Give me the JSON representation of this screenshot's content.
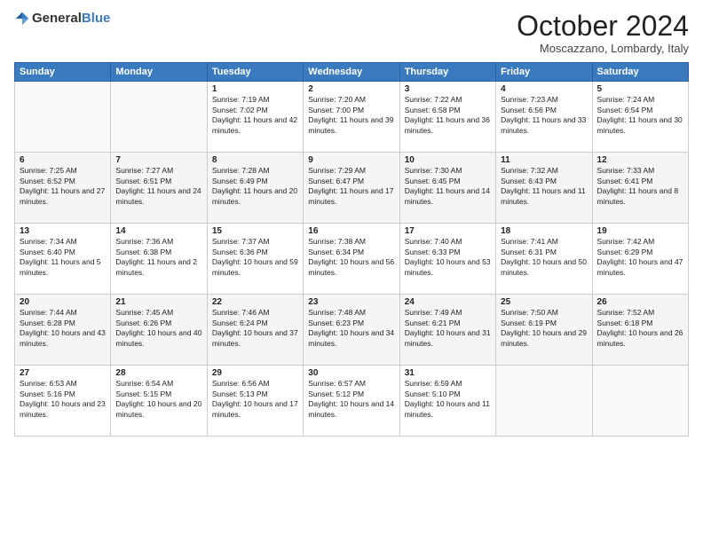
{
  "header": {
    "logo": {
      "general": "General",
      "blue": "Blue"
    },
    "title": "October 2024",
    "location": "Moscazzano, Lombardy, Italy"
  },
  "days_header": [
    "Sunday",
    "Monday",
    "Tuesday",
    "Wednesday",
    "Thursday",
    "Friday",
    "Saturday"
  ],
  "weeks": [
    [
      {
        "day": "",
        "content": ""
      },
      {
        "day": "",
        "content": ""
      },
      {
        "day": "1",
        "content": "Sunrise: 7:19 AM\nSunset: 7:02 PM\nDaylight: 11 hours and 42 minutes."
      },
      {
        "day": "2",
        "content": "Sunrise: 7:20 AM\nSunset: 7:00 PM\nDaylight: 11 hours and 39 minutes."
      },
      {
        "day": "3",
        "content": "Sunrise: 7:22 AM\nSunset: 6:58 PM\nDaylight: 11 hours and 36 minutes."
      },
      {
        "day": "4",
        "content": "Sunrise: 7:23 AM\nSunset: 6:56 PM\nDaylight: 11 hours and 33 minutes."
      },
      {
        "day": "5",
        "content": "Sunrise: 7:24 AM\nSunset: 6:54 PM\nDaylight: 11 hours and 30 minutes."
      }
    ],
    [
      {
        "day": "6",
        "content": "Sunrise: 7:25 AM\nSunset: 6:52 PM\nDaylight: 11 hours and 27 minutes."
      },
      {
        "day": "7",
        "content": "Sunrise: 7:27 AM\nSunset: 6:51 PM\nDaylight: 11 hours and 24 minutes."
      },
      {
        "day": "8",
        "content": "Sunrise: 7:28 AM\nSunset: 6:49 PM\nDaylight: 11 hours and 20 minutes."
      },
      {
        "day": "9",
        "content": "Sunrise: 7:29 AM\nSunset: 6:47 PM\nDaylight: 11 hours and 17 minutes."
      },
      {
        "day": "10",
        "content": "Sunrise: 7:30 AM\nSunset: 6:45 PM\nDaylight: 11 hours and 14 minutes."
      },
      {
        "day": "11",
        "content": "Sunrise: 7:32 AM\nSunset: 6:43 PM\nDaylight: 11 hours and 11 minutes."
      },
      {
        "day": "12",
        "content": "Sunrise: 7:33 AM\nSunset: 6:41 PM\nDaylight: 11 hours and 8 minutes."
      }
    ],
    [
      {
        "day": "13",
        "content": "Sunrise: 7:34 AM\nSunset: 6:40 PM\nDaylight: 11 hours and 5 minutes."
      },
      {
        "day": "14",
        "content": "Sunrise: 7:36 AM\nSunset: 6:38 PM\nDaylight: 11 hours and 2 minutes."
      },
      {
        "day": "15",
        "content": "Sunrise: 7:37 AM\nSunset: 6:36 PM\nDaylight: 10 hours and 59 minutes."
      },
      {
        "day": "16",
        "content": "Sunrise: 7:38 AM\nSunset: 6:34 PM\nDaylight: 10 hours and 56 minutes."
      },
      {
        "day": "17",
        "content": "Sunrise: 7:40 AM\nSunset: 6:33 PM\nDaylight: 10 hours and 53 minutes."
      },
      {
        "day": "18",
        "content": "Sunrise: 7:41 AM\nSunset: 6:31 PM\nDaylight: 10 hours and 50 minutes."
      },
      {
        "day": "19",
        "content": "Sunrise: 7:42 AM\nSunset: 6:29 PM\nDaylight: 10 hours and 47 minutes."
      }
    ],
    [
      {
        "day": "20",
        "content": "Sunrise: 7:44 AM\nSunset: 6:28 PM\nDaylight: 10 hours and 43 minutes."
      },
      {
        "day": "21",
        "content": "Sunrise: 7:45 AM\nSunset: 6:26 PM\nDaylight: 10 hours and 40 minutes."
      },
      {
        "day": "22",
        "content": "Sunrise: 7:46 AM\nSunset: 6:24 PM\nDaylight: 10 hours and 37 minutes."
      },
      {
        "day": "23",
        "content": "Sunrise: 7:48 AM\nSunset: 6:23 PM\nDaylight: 10 hours and 34 minutes."
      },
      {
        "day": "24",
        "content": "Sunrise: 7:49 AM\nSunset: 6:21 PM\nDaylight: 10 hours and 31 minutes."
      },
      {
        "day": "25",
        "content": "Sunrise: 7:50 AM\nSunset: 6:19 PM\nDaylight: 10 hours and 29 minutes."
      },
      {
        "day": "26",
        "content": "Sunrise: 7:52 AM\nSunset: 6:18 PM\nDaylight: 10 hours and 26 minutes."
      }
    ],
    [
      {
        "day": "27",
        "content": "Sunrise: 6:53 AM\nSunset: 5:16 PM\nDaylight: 10 hours and 23 minutes."
      },
      {
        "day": "28",
        "content": "Sunrise: 6:54 AM\nSunset: 5:15 PM\nDaylight: 10 hours and 20 minutes."
      },
      {
        "day": "29",
        "content": "Sunrise: 6:56 AM\nSunset: 5:13 PM\nDaylight: 10 hours and 17 minutes."
      },
      {
        "day": "30",
        "content": "Sunrise: 6:57 AM\nSunset: 5:12 PM\nDaylight: 10 hours and 14 minutes."
      },
      {
        "day": "31",
        "content": "Sunrise: 6:59 AM\nSunset: 5:10 PM\nDaylight: 10 hours and 11 minutes."
      },
      {
        "day": "",
        "content": ""
      },
      {
        "day": "",
        "content": ""
      }
    ]
  ]
}
